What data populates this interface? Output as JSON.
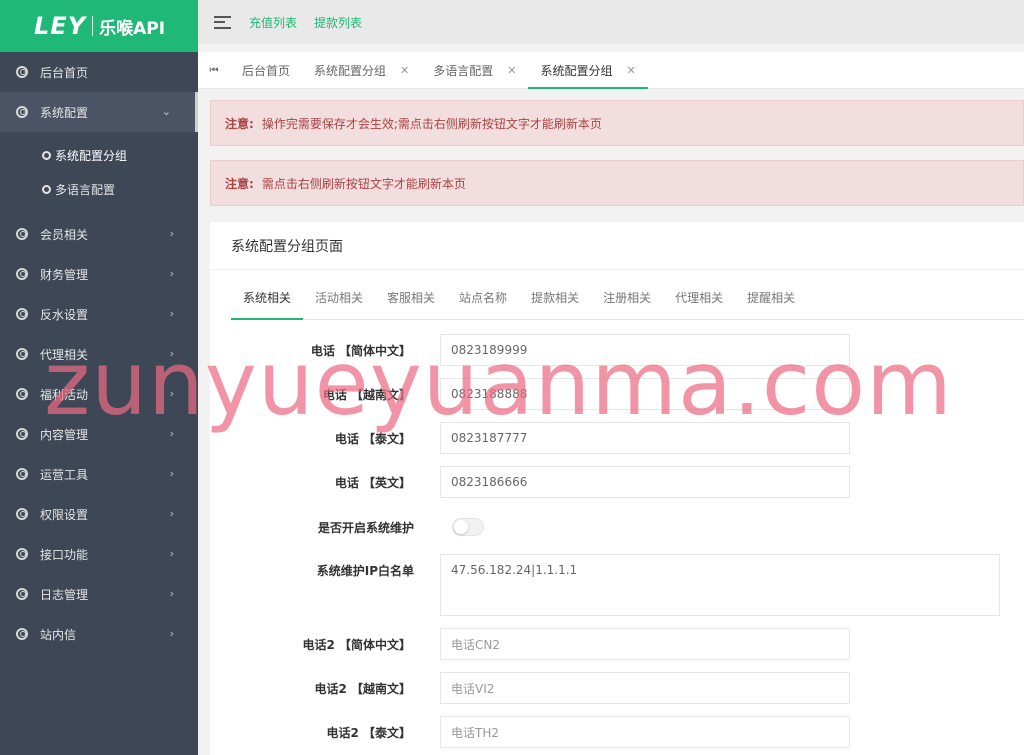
{
  "logo": {
    "mark": "LEY",
    "text": "乐喉API"
  },
  "sidebar": {
    "items": [
      {
        "label": "后台首页"
      },
      {
        "label": "系统配置"
      },
      {
        "label": "会员相关"
      },
      {
        "label": "财务管理"
      },
      {
        "label": "反水设置"
      },
      {
        "label": "代理相关"
      },
      {
        "label": "福利活动"
      },
      {
        "label": "内容管理"
      },
      {
        "label": "运营工具"
      },
      {
        "label": "权限设置"
      },
      {
        "label": "接口功能"
      },
      {
        "label": "日志管理"
      },
      {
        "label": "站内信"
      }
    ],
    "submenu": [
      {
        "label": "系统配置分组"
      },
      {
        "label": "多语言配置"
      }
    ]
  },
  "topbar": {
    "links": [
      "充值列表",
      "提款列表"
    ]
  },
  "tabs": [
    {
      "label": "后台首页"
    },
    {
      "label": "系统配置分组"
    },
    {
      "label": "多语言配置"
    },
    {
      "label": "系统配置分组"
    }
  ],
  "notices": [
    {
      "prefix": "注意:",
      "text": "操作完需要保存才会生效;需点击右侧刷新按钮文字才能刷新本页"
    },
    {
      "prefix": "注意:",
      "text": "需点击右侧刷新按钮文字才能刷新本页"
    }
  ],
  "panel": {
    "title": "系统配置分组页面",
    "subtabs": [
      "系统相关",
      "活动相关",
      "客服相关",
      "站点名称",
      "提款相关",
      "注册相关",
      "代理相关",
      "提醒相关"
    ],
    "fields": [
      {
        "label": "电话 【简体中文】",
        "value": "0823189999"
      },
      {
        "label": "电话 【越南文】",
        "value": "0823188888"
      },
      {
        "label": "电话 【泰文】",
        "value": "0823187777"
      },
      {
        "label": "电话 【英文】",
        "value": "0823186666"
      },
      {
        "label": "是否开启系统维护"
      },
      {
        "label": "系统维护IP白名单",
        "value": "47.56.182.24|1.1.1.1"
      },
      {
        "label": "电话2 【简体中文】",
        "value": "电话CN2"
      },
      {
        "label": "电话2 【越南文】",
        "value": "电话VI2"
      },
      {
        "label": "电话2 【泰文】",
        "value": "电话TH2"
      }
    ]
  },
  "watermark": "zunyueyuanma.com",
  "colors": {
    "accent": "#1fb877",
    "sidebar": "#3d4756",
    "alert_bg": "#f2dede",
    "alert_text": "#a94442"
  }
}
